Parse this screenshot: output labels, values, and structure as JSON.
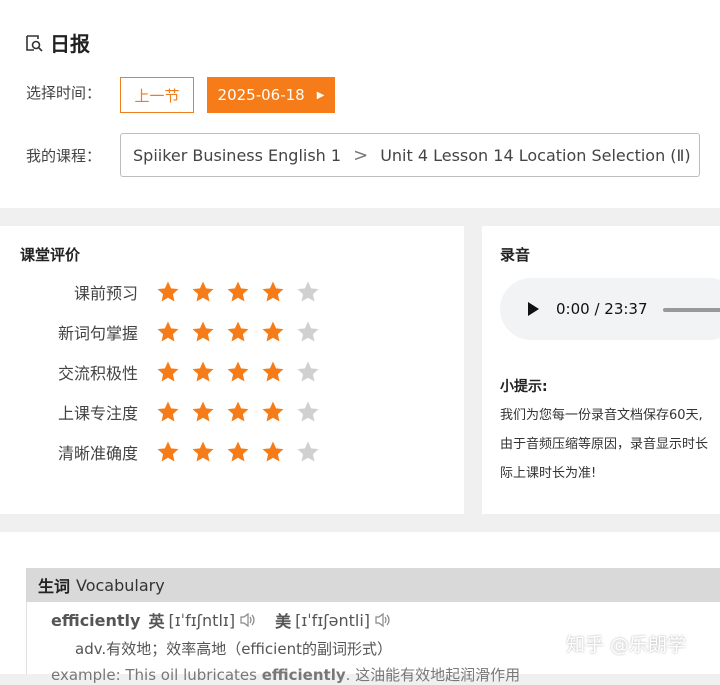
{
  "header": {
    "title": "日报",
    "select_time_label": "选择时间：",
    "prev_label": "上一节",
    "date_label": "2025-06-18",
    "course_label": "我的课程：",
    "course_name": "Spiiker Business English 1",
    "lesson_name": "Unit 4 Lesson 14 Location Selection (Ⅱ)"
  },
  "evaluation": {
    "title": "课堂评价",
    "items": [
      {
        "label": "课前预习",
        "stars": 4,
        "max": 5
      },
      {
        "label": "新词句掌握",
        "stars": 4,
        "max": 5
      },
      {
        "label": "交流积极性",
        "stars": 4,
        "max": 5
      },
      {
        "label": "上课专注度",
        "stars": 4,
        "max": 5
      },
      {
        "label": "清晰准确度",
        "stars": 4,
        "max": 5
      }
    ]
  },
  "recording": {
    "title": "录音",
    "time": "0:00 / 23:37",
    "tip_title": "小提示:",
    "tip_lines": [
      "我们为您每一份录音文档保存60天,",
      "由于音频压缩等原因，录音显示时长",
      "际上课时长为准!"
    ]
  },
  "vocabulary": {
    "header_zh": "生词",
    "header_en": "Vocabulary",
    "word": "efficiently",
    "uk_label": "英",
    "uk_phonetic": "[ɪˈfɪʃntlɪ]",
    "us_label": "美",
    "us_phonetic": "[ɪˈfɪʃəntli]",
    "definition": "adv.有效地；效率高地（efficient的副词形式）",
    "example_prefix": "example: This oil lubricates ",
    "example_word": "efficiently",
    "example_suffix": ". 这油能有效地起润滑作用"
  },
  "watermark": "知乎 @乐朗学",
  "colors": {
    "accent": "#f57c18",
    "star_on": "#f57c18",
    "star_off": "#d0d0d0"
  }
}
